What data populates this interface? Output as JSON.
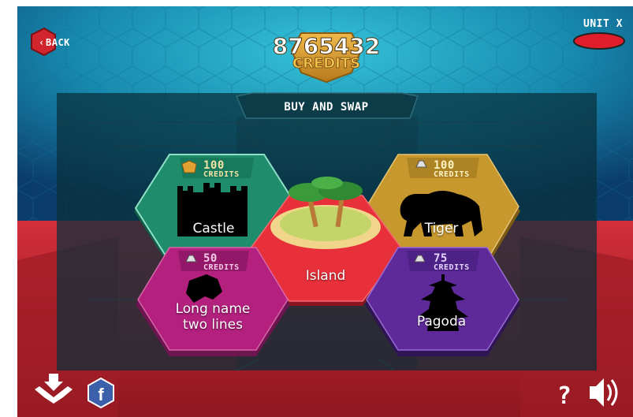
{
  "header": {
    "back_label": "BACK",
    "credits_amount": "8765432",
    "credits_label": "CREDITS",
    "unit_label": "UNIT X"
  },
  "panel": {
    "title": "BUY AND SWAP"
  },
  "items": [
    {
      "name": "Castle",
      "price": "100",
      "price_label": "CREDITS",
      "price_icon": "gold-pentagon-icon",
      "color": "#1e8a6e"
    },
    {
      "name": "Tiger",
      "price": "100",
      "price_label": "CREDITS",
      "price_icon": "silver-weight-icon",
      "color": "#c6982e"
    },
    {
      "name": "Island",
      "color": "#e8303a"
    },
    {
      "name": "Long name\ntwo lines",
      "price": "50",
      "price_label": "CREDITS",
      "price_icon": "silver-weight-icon",
      "color": "#b3207e"
    },
    {
      "name": "Pagoda",
      "price": "75",
      "price_label": "CREDITS",
      "price_icon": "silver-weight-icon",
      "color": "#5e2a9a"
    }
  ],
  "footer": {
    "download_icon": "download-icon",
    "facebook_icon": "facebook-icon",
    "help_icon": "help-icon",
    "sound_icon": "sound-icon"
  },
  "colors": {
    "top_bg": "#1a8fb0",
    "bottom_bg": "#c82a35",
    "panel_bg": "#0d2a33"
  }
}
